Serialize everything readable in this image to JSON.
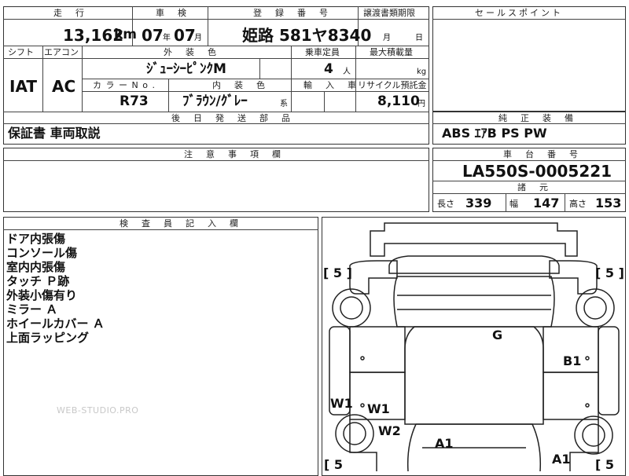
{
  "top": {
    "headers": {
      "mileage": "走　行",
      "inspection": "車　検",
      "registration": "登　録　番　号",
      "transfer": "譲渡書類期限",
      "sales": "セールスポイント"
    },
    "mileage_value": "13,162",
    "mileage_unit": "km",
    "inspection_year": "07",
    "inspection_year_unit": "年",
    "inspection_month": "07",
    "inspection_month_unit": "月",
    "plate": "姫路 581ヤ8340",
    "transfer_month_unit": "月",
    "transfer_day_unit": "日"
  },
  "row2": {
    "headers": {
      "shift": "シフト",
      "ac": "エアコン",
      "exterior": "外　装　色",
      "capacity": "乗車定員",
      "load": "最大積載量",
      "color_no": "カ ラ ー N o .",
      "interior": "内　装　色",
      "import": "輸　入　車",
      "recycle": "リサイクル預託金"
    },
    "shift": "IAT",
    "ac": "AC",
    "exterior_color": "ｼﾞｭｰｼｰﾋﾟﾝｸM",
    "capacity": "4",
    "capacity_unit": "人",
    "load_unit": "kg",
    "color_no": "R73",
    "interior_color": "ﾌﾞﾗｳﾝ/ｸﾞﾚｰ",
    "interior_suffix": "系",
    "recycle": "8,110",
    "recycle_unit": "円"
  },
  "later_parts": {
    "header": "後　日　発　送　部　品",
    "value": "保証書 車両取説"
  },
  "equipment": {
    "header": "純　正　装　備",
    "value": "ABS ｴｱB PS PW"
  },
  "notes_section": {
    "header": "注　意　事　項　欄"
  },
  "chassis": {
    "header": "車　台　番　号",
    "value": "LA550S-0005221"
  },
  "specs": {
    "header": "諸　元",
    "length_label": "長さ",
    "length": "339",
    "width_label": "幅",
    "width": "147",
    "height_label": "高さ",
    "height": "153"
  },
  "inspector": {
    "header": "検　査　員　記　入　欄",
    "notes": [
      "ドア内張傷",
      "コンソール傷",
      "室内内張傷",
      "タッチ Ｐ跡",
      "外装小傷有り",
      "ミラー Ａ",
      "ホイールカバー Ａ",
      "上面ラッピング"
    ]
  },
  "diagram_marks": {
    "tl": "[ 5 ]",
    "tr": "[ 5 ]",
    "bl": "[ 5",
    "br": "[ 5",
    "g": "G",
    "b1": "B1",
    "w1_left": "W1",
    "w1_inner": "W1",
    "w2": "W2",
    "a1_left": "A1",
    "a1_right": "A1"
  },
  "watermark": "WEB-STUDIO.PRO"
}
